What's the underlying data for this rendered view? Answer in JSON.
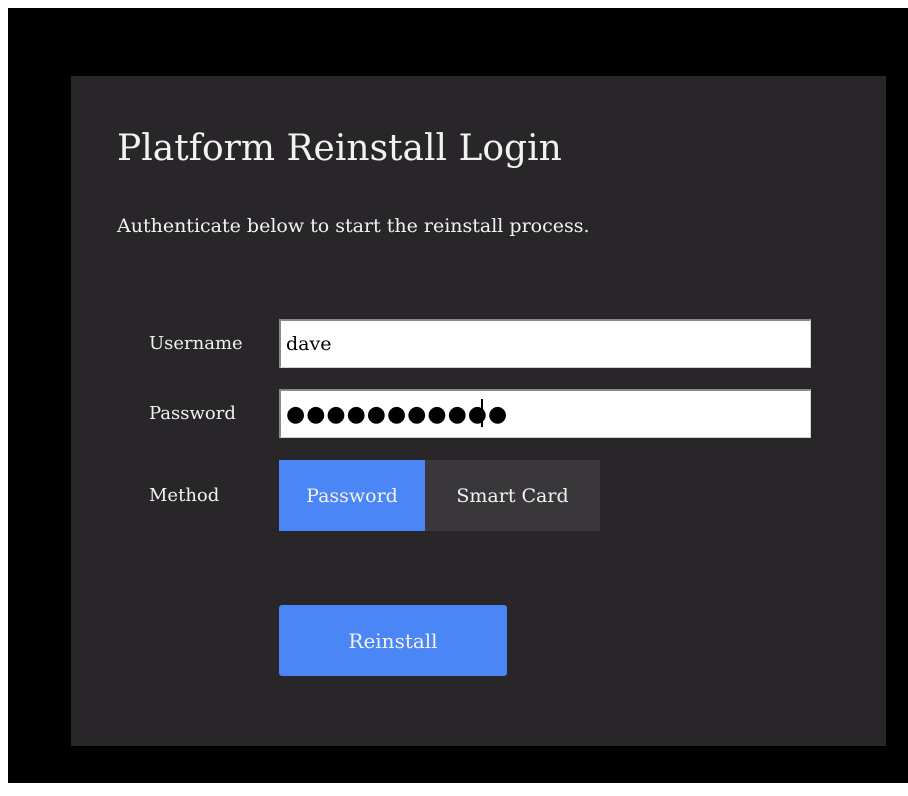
{
  "login": {
    "title": "Platform Reinstall Login",
    "subtitle": "Authenticate below to start the reinstall process.",
    "username_label": "Username",
    "username_value": "dave",
    "password_label": "Password",
    "password_value": "●●●●●●●●●●●",
    "method_label": "Method",
    "method_options": [
      {
        "label": "Password",
        "selected": true
      },
      {
        "label": "Smart Card",
        "selected": false
      }
    ],
    "submit_label": "Reinstall"
  },
  "colors": {
    "outer_background": "#000000",
    "panel_background": "#29262a",
    "accent": "#4a86f5",
    "inactive_segment": "#3a373b",
    "text": "#f2f2f2"
  }
}
